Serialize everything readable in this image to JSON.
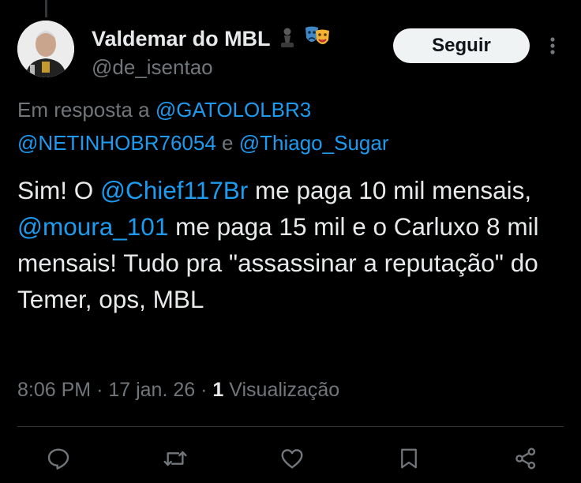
{
  "author": {
    "name": "Valdemar do MBL",
    "handle": "@de_isentao",
    "name_emoji": [
      "chess-pawn-icon",
      "theater-masks-icon"
    ]
  },
  "follow_button": {
    "label": "Seguir"
  },
  "reply_context": {
    "prefix": "Em resposta a",
    "mentions": [
      "@GATOLOLBR3",
      "@NETINHOBR76054",
      "@Thiago_Sugar"
    ],
    "conjunction": "e"
  },
  "tweet": {
    "text_segments": [
      {
        "text": "Sim! O ",
        "type": "text"
      },
      {
        "text": "@Chief117Br",
        "type": "mention"
      },
      {
        "text": " me paga 10 mil mensais, ",
        "type": "text"
      },
      {
        "text": "@moura_101",
        "type": "mention"
      },
      {
        "text": " me paga 15 mil e o Carluxo 8 mil mensais! Tudo pra \"assassinar a reputação\" do Temer, ops, MBL",
        "type": "text"
      }
    ]
  },
  "meta": {
    "time": "8:06 PM",
    "separator": "·",
    "date": "17 jan. 26",
    "views_count": "1",
    "views_label": "Visualização"
  },
  "actions": [
    {
      "name": "reply-icon"
    },
    {
      "name": "repost-icon"
    },
    {
      "name": "like-icon"
    },
    {
      "name": "bookmark-icon"
    },
    {
      "name": "share-icon"
    }
  ],
  "colors": {
    "background": "#000000",
    "text": "#e7e9ea",
    "secondary": "#71767b",
    "link": "#1d9bf0",
    "button_bg": "#eff3f4"
  }
}
